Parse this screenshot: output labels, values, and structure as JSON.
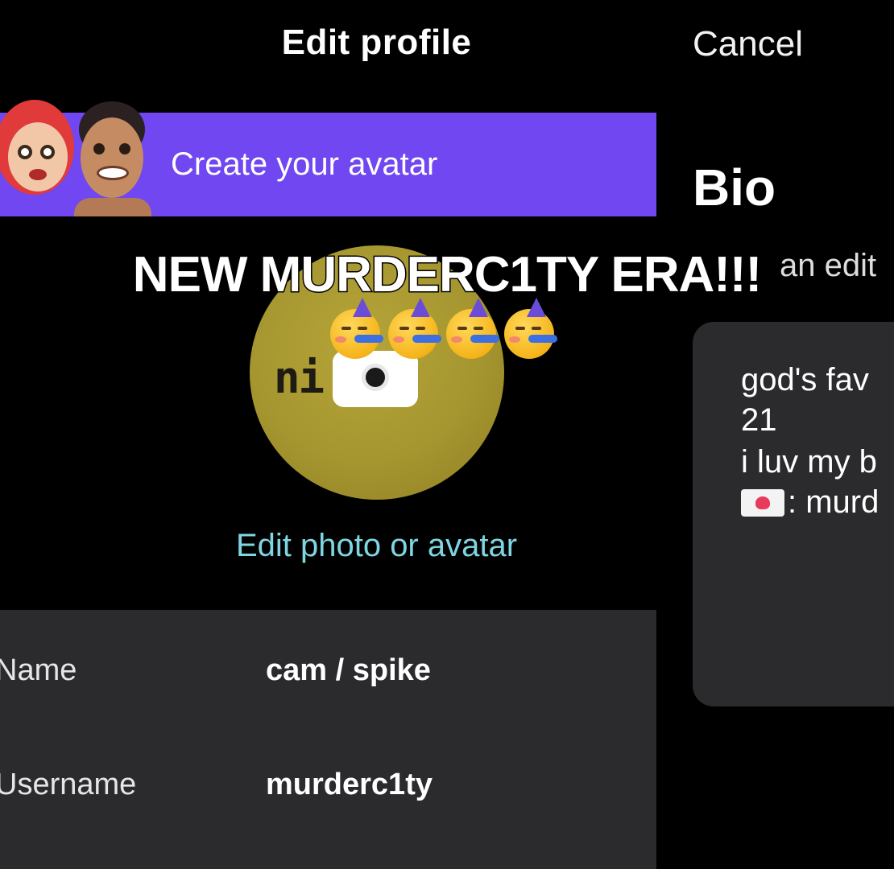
{
  "header": {
    "title": "Edit profile",
    "cancel_label": "Cancel"
  },
  "avatar_banner": {
    "label": "Create your avatar",
    "color": "#7047f0"
  },
  "bio": {
    "heading": "Bio",
    "hint_partial": "an edit",
    "lines": [
      "god's fav",
      "21",
      "i luv my b",
      ": murd"
    ]
  },
  "photo": {
    "logo_text": "ni    d.",
    "edit_label": "Edit photo or avatar",
    "edit_color": "#7fd6e2"
  },
  "overlay": {
    "caption": "NEW MURDERC1TY ERA!!!",
    "emoji": [
      "partying-face",
      "partying-face",
      "partying-face",
      "partying-face"
    ]
  },
  "fields": [
    {
      "label": "Name",
      "value": "cam / spike"
    },
    {
      "label": "Username",
      "value": "murderc1ty"
    }
  ],
  "icons": [
    "camera-icon",
    "envelope-heart-icon",
    "partying-face-emoji"
  ]
}
